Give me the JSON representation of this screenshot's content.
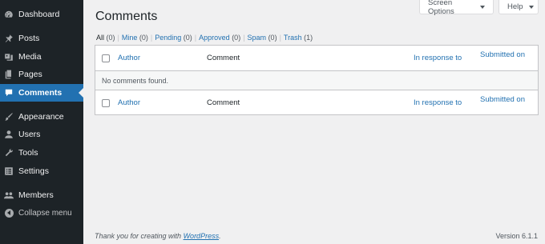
{
  "sidebar": {
    "items": [
      {
        "label": "Dashboard",
        "icon": "dashboard-icon"
      },
      {
        "label": "Posts",
        "icon": "pin-icon"
      },
      {
        "label": "Media",
        "icon": "media-icon"
      },
      {
        "label": "Pages",
        "icon": "page-icon"
      },
      {
        "label": "Comments",
        "icon": "comment-icon",
        "active": true
      },
      {
        "label": "Appearance",
        "icon": "paintbrush-icon"
      },
      {
        "label": "Users",
        "icon": "user-icon"
      },
      {
        "label": "Tools",
        "icon": "wrench-icon"
      },
      {
        "label": "Settings",
        "icon": "settings-icon"
      },
      {
        "label": "Members",
        "icon": "members-icon"
      }
    ],
    "collapse_label": "Collapse menu"
  },
  "header": {
    "screen_options_label": "Screen Options",
    "help_label": "Help",
    "title": "Comments"
  },
  "filters": [
    {
      "label": "All",
      "count": "(0)"
    },
    {
      "label": "Mine",
      "count": "(0)"
    },
    {
      "label": "Pending",
      "count": "(0)"
    },
    {
      "label": "Approved",
      "count": "(0)"
    },
    {
      "label": "Spam",
      "count": "(0)"
    },
    {
      "label": "Trash",
      "count": "(1)"
    }
  ],
  "table": {
    "columns": {
      "author": "Author",
      "comment": "Comment",
      "in_response_to": "In response to",
      "submitted_on": "Submitted on"
    },
    "empty_message": "No comments found."
  },
  "footer": {
    "thanks_prefix": "Thank you for creating with ",
    "thanks_link": "WordPress",
    "thanks_suffix": ".",
    "version": "Version 6.1.1"
  },
  "colors": {
    "sidebar_bg": "#1d2327",
    "accent": "#2271b1",
    "page_bg": "#f0f0f1"
  }
}
